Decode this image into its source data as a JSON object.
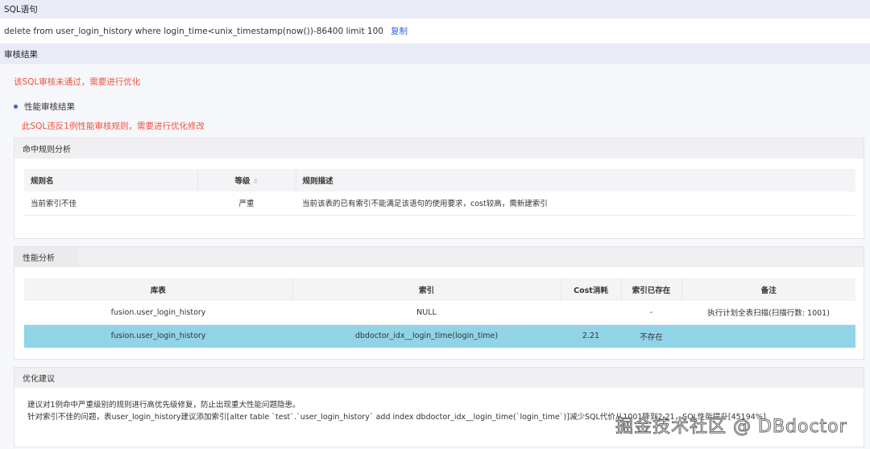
{
  "sql_section": {
    "title": "SQL语句",
    "statement": "delete from user_login_history where login_time<unix_timestamp(now())-86400 limit 100",
    "copy_label": "复制"
  },
  "result_section": {
    "title": "审核结果",
    "status": "该SQL审核未通过，需要进行优化",
    "perf_heading": "性能审核结果",
    "perf_message": "此SQL违反1例性能审核规则，需要进行优化修改"
  },
  "rules_card": {
    "title": "命中规则分析",
    "columns": [
      "规则名",
      "等级",
      "规则描述"
    ],
    "rows": [
      {
        "name": "当前索引不佳",
        "level": "严重",
        "desc": "当前该表的已有索引不能满足该语句的使用要求，cost较高，需新建索引"
      }
    ]
  },
  "perf_card": {
    "tab": "性能分析",
    "columns": [
      "库表",
      "索引",
      "Cost消耗",
      "索引已存在",
      "备注"
    ],
    "rows": [
      {
        "table": "fusion.user_login_history",
        "index": "NULL",
        "cost": "",
        "exists": "-",
        "note": "执行计划全表扫描(扫描行数: 1001)"
      },
      {
        "table": "fusion.user_login_history",
        "index": "dbdoctor_idx__login_time(login_time)",
        "cost": "2.21",
        "exists": "不存在",
        "note": ""
      }
    ]
  },
  "advice_card": {
    "title": "优化建议",
    "lines": [
      "建议对1例命中严重级别的规则进行高优先级修复，防止出现重大性能问题隐患。",
      "针对索引不佳的问题，表user_login_history建议添加索引[alter table `test`.`user_login_history` add index dbdoctor_idx__login_time(`login_time`)]减少SQL代价从1001降到2.21，SQL性能提升[45194%]"
    ]
  },
  "watermark": "掘金技术社区 @ DBdoctor",
  "colors": {
    "accent": "#3a62d7",
    "error": "#f0523c",
    "highlight_row": "#91d4e7"
  }
}
